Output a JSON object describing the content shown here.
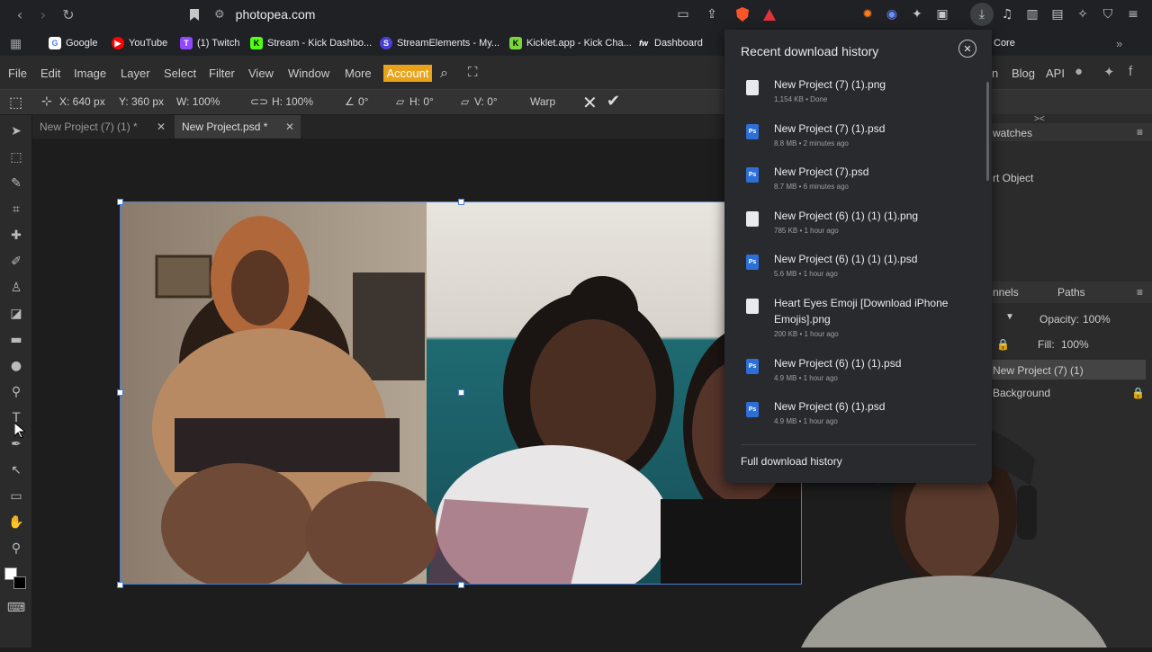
{
  "browser": {
    "url": "photopea.com",
    "bookmarks": [
      {
        "label": "Google",
        "color": "#ffffff",
        "glyph": "G"
      },
      {
        "label": "YouTube",
        "color": "#ff0000",
        "glyph": "▶"
      },
      {
        "label": "(1) Twitch",
        "color": "#9146ff",
        "glyph": "T"
      },
      {
        "label": "Stream - Kick Dashbo...",
        "color": "#53fc18",
        "glyph": "K"
      },
      {
        "label": "StreamElements - My...",
        "color": "#4a3fd8",
        "glyph": "S"
      },
      {
        "label": "Kicklet.app - Kick Cha...",
        "color": "#7ad63a",
        "glyph": "K"
      },
      {
        "label": "Dashboard",
        "color": "#222222",
        "glyph": "fw"
      },
      {
        "label": "Core",
        "color": "#333333",
        "glyph": ""
      }
    ]
  },
  "photopea": {
    "menu": [
      "File",
      "Edit",
      "Image",
      "Layer",
      "Select",
      "Filter",
      "View",
      "Window",
      "More"
    ],
    "account_label": "Account",
    "right_menu": [
      "n",
      "Blog",
      "API"
    ],
    "options": {
      "x": "X: 640 px",
      "y": "Y: 360 px",
      "w": "W: 100%",
      "h": "H: 100%",
      "angle": "0°",
      "h_skew": "H: 0°",
      "v_skew": "V: 0°",
      "warp": "Warp"
    },
    "tabs": [
      {
        "label": "New Project (7) (1) *",
        "active": false
      },
      {
        "label": "New Project.psd *",
        "active": true
      }
    ],
    "right_panel": {
      "swatches": "watches",
      "smart_object": "rt Object",
      "channels": "nnels",
      "paths": "Paths",
      "opacity_label": "Opacity:",
      "opacity_value": "100%",
      "fill_label": "Fill:",
      "fill_value": "100%",
      "layer1": "New Project (7) (1)",
      "layer2": "Background"
    }
  },
  "downloads": {
    "title": "Recent download history",
    "footer": "Full download history",
    "items": [
      {
        "name": "New Project (7) (1).png",
        "meta": "1,154 KB • Done",
        "type": "png"
      },
      {
        "name": "New Project (7) (1).psd",
        "meta": "8.8 MB • 2 minutes ago",
        "type": "psd"
      },
      {
        "name": "New Project (7).psd",
        "meta": "8.7 MB • 6 minutes ago",
        "type": "psd"
      },
      {
        "name": "New Project (6) (1) (1) (1).png",
        "meta": "785 KB • 1 hour ago",
        "type": "png"
      },
      {
        "name": "New Project (6) (1) (1) (1).psd",
        "meta": "5.6 MB • 1 hour ago",
        "type": "psd"
      },
      {
        "name": "Heart Eyes Emoji [Download iPhone Emojis].png",
        "meta": "200 KB • 1 hour ago",
        "type": "png"
      },
      {
        "name": "New Project (6) (1) (1).psd",
        "meta": "4.9 MB • 1 hour ago",
        "type": "psd"
      },
      {
        "name": "New Project (6) (1).psd",
        "meta": "4.9 MB • 1 hour ago",
        "type": "psd"
      }
    ]
  },
  "colors": {
    "accent": "#e8a31a",
    "selection": "#4a7fd8",
    "ps_icon": "#2d6fd6"
  }
}
